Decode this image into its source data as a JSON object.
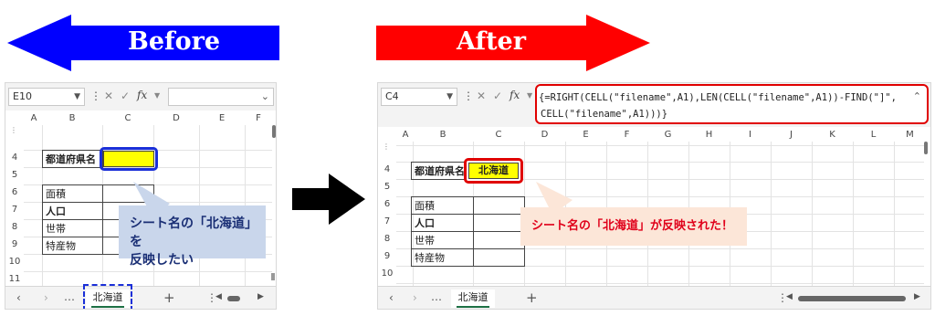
{
  "before_arrow": {
    "label": "Before",
    "color": "#0000ff"
  },
  "after_arrow": {
    "label": "After",
    "color": "#ff0000"
  },
  "transition_arrow": {
    "icon": "right-arrow-icon",
    "color": "#000000"
  },
  "before": {
    "name_box": "E10",
    "formula": "",
    "fx_label": "fx",
    "columns": [
      "A",
      "B",
      "C",
      "D",
      "E",
      "F"
    ],
    "rows": [
      "4",
      "5",
      "6",
      "7",
      "8",
      "9",
      "10",
      "11"
    ],
    "cells": {
      "b4": "都道府県名",
      "b6": "面積",
      "b7": "人口",
      "b8": "世帯",
      "b9": "特産物"
    },
    "sheet_tab": "北海道",
    "tab_more": "…",
    "tab_add": "+",
    "callout": {
      "line1": "シート名の「北海道」を",
      "line2": "反映したい"
    }
  },
  "after": {
    "name_box": "C4",
    "formula_line1": "{=RIGHT(CELL(\"filename\",A1),LEN(CELL(\"filename\",A1))-FIND(\"]\",",
    "formula_line2": "CELL(\"filename\",A1)))}",
    "fx_label": "fx",
    "columns": [
      "A",
      "B",
      "C",
      "D",
      "E",
      "F",
      "G",
      "H",
      "I",
      "J",
      "K",
      "L",
      "M"
    ],
    "rows": [
      "4",
      "5",
      "6",
      "7",
      "8",
      "9",
      "10"
    ],
    "cells": {
      "b4": "都道府県名",
      "c4": "北海道",
      "b6": "面積",
      "b7": "人口",
      "b8": "世帯",
      "b9": "特産物"
    },
    "sheet_tab": "北海道",
    "tab_more": "…",
    "tab_add": "+",
    "callout": {
      "line1": "シート名の「北海道」が反映された！"
    }
  },
  "colors": {
    "highlight_yellow": "#ffff00",
    "blue_frame": "#1a2fd8",
    "red_frame": "#e00000",
    "tab_underline": "#1e7145"
  }
}
